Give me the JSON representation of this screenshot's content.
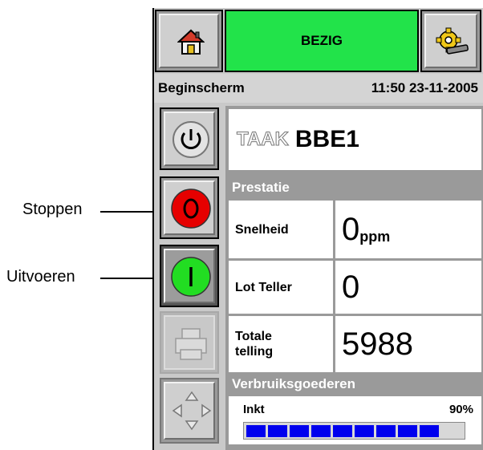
{
  "header": {
    "status": "BEZIG",
    "home_icon": "home-icon",
    "settings_icon": "gear-wrench-icon"
  },
  "title_bar": {
    "title": "Beginscherm",
    "datetime": "11:50 23-11-2005"
  },
  "job": {
    "label": "TAAK",
    "name": "BBE1"
  },
  "performance": {
    "heading": "Prestatie",
    "rows": [
      {
        "label": "Snelheid",
        "value": "0",
        "unit": "ppm"
      },
      {
        "label": "Lot Teller",
        "value": "0"
      },
      {
        "label": "Totale telling",
        "value": "5988"
      }
    ]
  },
  "consumables": {
    "heading": "Verbruiksgoederen",
    "ink_label": "Inkt",
    "ink_percent_text": "90%",
    "ink_level": 0.9,
    "ink_segments": 10
  },
  "side_buttons": {
    "power_icon": "power-icon",
    "stop_icon": "stop-icon",
    "run_icon": "run-icon",
    "print_icon": "printer-icon",
    "nav_icon": "arrows-nav-icon"
  },
  "callouts": {
    "stop": "Stoppen",
    "run": "Uitvoeren"
  },
  "colors": {
    "status_green": "#22e34a",
    "stop_red": "#e60000",
    "run_green": "#22dd22",
    "ink_blue": "#0000ee"
  }
}
